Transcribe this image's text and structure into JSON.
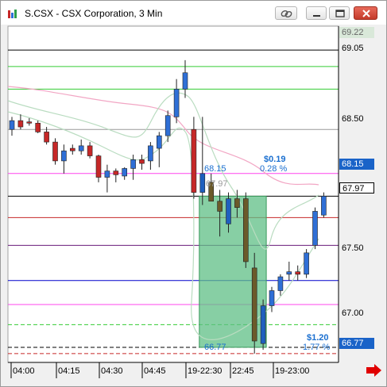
{
  "window": {
    "title": "S.CSX - CSX Corporation, 3 Min",
    "buttons": [
      "link",
      "minimize",
      "maximize",
      "close"
    ]
  },
  "colors": {
    "up": "#2f6fd6",
    "down": "#c62828",
    "bull_box": "#5fbf85",
    "annotation_text": "#1a6fd0",
    "highlight_label": "#1a63c8",
    "right_arrow": "#e00000"
  },
  "price_axis": {
    "labels": [
      "69.22",
      "69.05",
      "68.50",
      "68.15",
      "67.97",
      "67.50",
      "67.00",
      "66.77"
    ],
    "highlighted": [
      "68.15",
      "66.77"
    ],
    "outlined": [
      "67.97"
    ]
  },
  "time_axis": {
    "labels": [
      "04:00",
      "04:15",
      "04:30",
      "04:45",
      "19-22:30",
      "22:45",
      "19-23:00"
    ]
  },
  "annotations": {
    "top_change": "$0.19",
    "top_pct": "0.28 %",
    "top_price": "68.15",
    "box_price": "67.97",
    "bottom_change": "$1.20",
    "bottom_pct": "1.77 %",
    "bottom_price": "66.77"
  },
  "chart_data": {
    "type": "candlestick",
    "title": "S.CSX - CSX Corporation, 3 Min",
    "ylim": [
      66.65,
      69.32
    ],
    "candles": [
      {
        "o": 68.5,
        "h": 68.6,
        "l": 68.45,
        "c": 68.57
      },
      {
        "o": 68.57,
        "h": 68.62,
        "l": 68.5,
        "c": 68.52
      },
      {
        "o": 68.56,
        "h": 68.59,
        "l": 68.53,
        "c": 68.55
      },
      {
        "o": 68.55,
        "h": 68.57,
        "l": 68.47,
        "c": 68.48
      },
      {
        "o": 68.48,
        "h": 68.52,
        "l": 68.38,
        "c": 68.4
      },
      {
        "o": 68.4,
        "h": 68.43,
        "l": 68.22,
        "c": 68.25
      },
      {
        "o": 68.25,
        "h": 68.38,
        "l": 68.15,
        "c": 68.33
      },
      {
        "o": 68.35,
        "h": 68.38,
        "l": 68.3,
        "c": 68.33
      },
      {
        "o": 68.33,
        "h": 68.42,
        "l": 68.3,
        "c": 68.37
      },
      {
        "o": 68.37,
        "h": 68.4,
        "l": 68.27,
        "c": 68.29
      },
      {
        "o": 68.29,
        "h": 68.3,
        "l": 68.08,
        "c": 68.12
      },
      {
        "o": 68.12,
        "h": 68.22,
        "l": 68.0,
        "c": 68.17
      },
      {
        "o": 68.17,
        "h": 68.19,
        "l": 68.08,
        "c": 68.14
      },
      {
        "o": 68.13,
        "h": 68.2,
        "l": 68.1,
        "c": 68.19
      },
      {
        "o": 68.19,
        "h": 68.3,
        "l": 68.1,
        "c": 68.26
      },
      {
        "o": 68.26,
        "h": 68.3,
        "l": 68.18,
        "c": 68.23
      },
      {
        "o": 68.25,
        "h": 68.4,
        "l": 68.18,
        "c": 68.37
      },
      {
        "o": 68.35,
        "h": 68.48,
        "l": 68.2,
        "c": 68.45
      },
      {
        "o": 68.45,
        "h": 68.65,
        "l": 68.4,
        "c": 68.61
      },
      {
        "o": 68.6,
        "h": 68.9,
        "l": 68.55,
        "c": 68.82
      },
      {
        "o": 68.82,
        "h": 69.05,
        "l": 68.75,
        "c": 68.95
      },
      {
        "o": 68.5,
        "h": 68.6,
        "l": 67.95,
        "c": 68.0
      },
      {
        "o": 68.0,
        "h": 68.6,
        "l": 67.9,
        "c": 68.15
      },
      {
        "o": 68.08,
        "h": 68.15,
        "l": 67.95,
        "c": 67.93
      },
      {
        "o": 67.93,
        "h": 68.02,
        "l": 67.65,
        "c": 67.85
      },
      {
        "o": 67.75,
        "h": 68.0,
        "l": 67.68,
        "c": 67.95
      },
      {
        "o": 67.95,
        "h": 68.02,
        "l": 67.8,
        "c": 67.88
      },
      {
        "o": 67.95,
        "h": 68.0,
        "l": 67.4,
        "c": 67.45
      },
      {
        "o": 67.4,
        "h": 67.52,
        "l": 66.72,
        "c": 66.82
      },
      {
        "o": 66.8,
        "h": 67.15,
        "l": 66.75,
        "c": 67.1
      },
      {
        "o": 67.1,
        "h": 67.25,
        "l": 67.05,
        "c": 67.22
      },
      {
        "o": 67.22,
        "h": 67.35,
        "l": 67.18,
        "c": 67.33
      },
      {
        "o": 67.35,
        "h": 67.45,
        "l": 67.3,
        "c": 67.37
      },
      {
        "o": 67.37,
        "h": 67.42,
        "l": 67.3,
        "c": 67.35
      },
      {
        "o": 67.35,
        "h": 67.55,
        "l": 67.32,
        "c": 67.52
      },
      {
        "o": 67.58,
        "h": 67.88,
        "l": 67.55,
        "c": 67.85
      },
      {
        "o": 67.82,
        "h": 68.0,
        "l": 67.8,
        "c": 67.97
      }
    ],
    "levels": [
      {
        "price": 69.13,
        "color": "#000000",
        "dash": ""
      },
      {
        "price": 69.0,
        "color": "#33cc33",
        "dash": ""
      },
      {
        "price": 68.82,
        "color": "#33cc33",
        "dash": ""
      },
      {
        "price": 68.5,
        "color": "#999999",
        "dash": ""
      },
      {
        "price": 68.15,
        "color": "#ff44ee",
        "dash": ""
      },
      {
        "price": 67.97,
        "color": "#000000",
        "dash": ""
      },
      {
        "price": 67.8,
        "color": "#c62828",
        "dash": ""
      },
      {
        "price": 67.58,
        "color": "#6a1b7a",
        "dash": ""
      },
      {
        "price": 67.3,
        "color": "#0000cc",
        "dash": ""
      },
      {
        "price": 67.11,
        "color": "#ff44ee",
        "dash": ""
      },
      {
        "price": 66.95,
        "color": "#33cc33",
        "dash": "5,3"
      },
      {
        "price": 66.77,
        "color": "#000000",
        "dash": "5,3"
      },
      {
        "price": 66.72,
        "color": "#c62828",
        "dash": "5,3"
      }
    ],
    "bull_box": {
      "from_index": 22,
      "to_index": 29,
      "top": 67.97,
      "bottom": 66.77
    }
  }
}
